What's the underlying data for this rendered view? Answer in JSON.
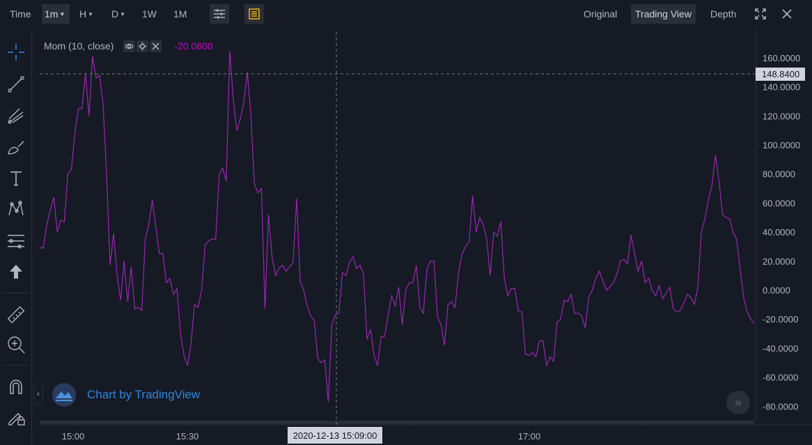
{
  "toolbar": {
    "time_label": "Time",
    "intervals": [
      "1m",
      "H",
      "D",
      "1W",
      "1M"
    ],
    "active_interval": "1m",
    "views": [
      "Original",
      "Trading View",
      "Depth"
    ],
    "active_view": "Trading View"
  },
  "indicator": {
    "name": "Mom (10, close)",
    "value": "-20.0600",
    "color": "#cc00cc"
  },
  "crosshair": {
    "price_label": "148.8400",
    "time_label": "2020-12-13 15:09:00"
  },
  "watermark": {
    "text": "Chart by TradingView"
  },
  "colors": {
    "background": "#161a25",
    "line": "#9c27b0",
    "watermark": "#2e86de",
    "price_tag": "#d1d4dc"
  },
  "chart_data": {
    "type": "line",
    "series": [
      {
        "name": "Mom (10, close)",
        "values": [
          29,
          29,
          45,
          55,
          64,
          40,
          48,
          47,
          80,
          83,
          108,
          125,
          125,
          149,
          120,
          161,
          146,
          148,
          128,
          80,
          17,
          39,
          10,
          -7,
          20,
          -8,
          16,
          -13,
          -12,
          -14,
          35,
          45,
          62,
          43,
          25,
          25,
          5,
          8,
          -3,
          1,
          -30,
          -45,
          -52,
          -37,
          -10,
          -12,
          0,
          31,
          34,
          35,
          35,
          80,
          84,
          75,
          165,
          131,
          110,
          118,
          129,
          150,
          120,
          73,
          67,
          70,
          -13,
          52,
          23,
          10,
          15,
          17,
          13,
          16,
          19,
          63,
          6,
          0,
          -11,
          -18,
          -21,
          -47,
          -50,
          -48,
          -77,
          -24,
          -17,
          -16,
          12,
          10,
          19,
          23,
          15,
          17,
          11,
          -34,
          -27,
          -45,
          -52,
          -32,
          -32,
          -17,
          -4,
          -11,
          2,
          -24,
          0,
          5,
          5,
          17,
          -12,
          -16,
          14,
          20,
          20,
          -18,
          -24,
          -38,
          -10,
          -8,
          -12,
          12,
          25,
          30,
          33,
          65,
          40,
          50,
          45,
          35,
          10,
          40,
          37,
          47,
          8,
          -4,
          1,
          1,
          -15,
          -15,
          -44,
          -45,
          -43,
          -46,
          -35,
          -35,
          -52,
          -46,
          -49,
          -22,
          -20,
          -7,
          -8,
          -3,
          -16,
          -16,
          -18,
          -26,
          -5,
          0,
          8,
          13,
          6,
          0,
          2,
          5,
          11,
          20,
          21,
          18,
          38,
          25,
          13,
          20,
          5,
          8,
          0,
          -4,
          3,
          -6,
          -2,
          2,
          -13,
          -15,
          -14,
          -9,
          -3,
          -5,
          -10,
          2,
          40,
          49,
          62,
          72,
          93,
          75,
          52,
          50,
          49,
          40,
          35,
          15,
          -5,
          -15,
          -20,
          -23
        ]
      }
    ],
    "x_ticks": [
      "15:00",
      "15:30",
      "17:00"
    ],
    "y_ticks": [
      "160.0000",
      "140.0000",
      "120.0000",
      "100.0000",
      "80.0000",
      "60.0000",
      "40.0000",
      "20.0000",
      "0.0000",
      "-20.0000",
      "-40.0000",
      "-60.0000",
      "-80.0000"
    ],
    "ylim": [
      -88,
      175
    ],
    "grid": false
  }
}
